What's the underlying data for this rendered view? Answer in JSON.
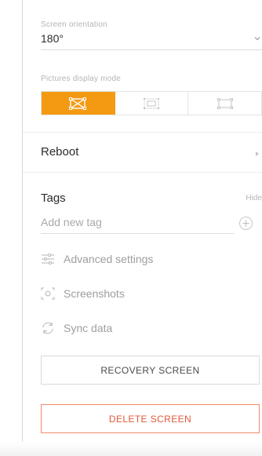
{
  "orientation": {
    "label": "Screen orientation",
    "value": "180°"
  },
  "display_mode": {
    "label": "Pictures display mode",
    "options": [
      {
        "icon": "fit-icon",
        "active": true
      },
      {
        "icon": "fill-icon",
        "active": false
      },
      {
        "icon": "stretch-icon",
        "active": false
      }
    ],
    "accent_color": "#f49a12"
  },
  "reboot": {
    "label": "Reboot"
  },
  "tags": {
    "title": "Tags",
    "hide_label": "Hide",
    "input_placeholder": "Add new tag"
  },
  "links": {
    "advanced": "Advanced settings",
    "screenshots": "Screenshots",
    "sync": "Sync data"
  },
  "buttons": {
    "recovery": "RECOVERY SCREEN",
    "delete": "DELETE SCREEN",
    "delete_color": "#e2573a"
  }
}
